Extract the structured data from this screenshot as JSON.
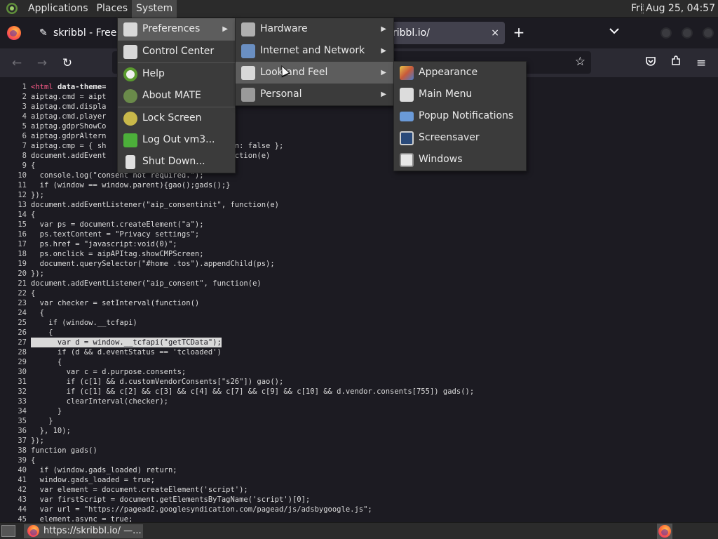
{
  "top_panel": {
    "menus": [
      "Applications",
      "Places",
      "System"
    ],
    "clock": "Fri Aug 25, 04:57"
  },
  "browser": {
    "tab1_title": "skribbl - Free M",
    "tab2_title": "ribbl.io/",
    "tab_close": "×",
    "new_tab": "+"
  },
  "system_menu": {
    "items": [
      "Preferences",
      "Control Center",
      "Help",
      "About MATE",
      "Lock Screen",
      "Log Out vm3...",
      "Shut Down..."
    ]
  },
  "preferences_menu": {
    "items": [
      "Hardware",
      "Internet and Network",
      "Look and Feel",
      "Personal"
    ]
  },
  "look_and_feel_menu": {
    "items": [
      "Appearance",
      "Main Menu",
      "Popup Notifications",
      "Screensaver",
      "Windows"
    ]
  },
  "code": {
    "line1_tag": "<html",
    "line1_attr": "data-theme=",
    "lines": [
      {
        "n": "1",
        "t": ""
      },
      {
        "n": "2",
        "t": "aiptag.cmd = aipt"
      },
      {
        "n": "3",
        "t": "aiptag.cmd.displa                 || [];"
      },
      {
        "n": "4",
        "t": "aiptag.cmd.player                 [];"
      },
      {
        "n": "5",
        "t": "aiptag.gdprShowCo"
      },
      {
        "n": "6",
        "t": "aiptag.gdprAltern                 e;"
      },
      {
        "n": "7",
        "t": "aiptag.cmp = { sh               ntered\", button: false };"
      },
      {
        "n": "8",
        "t": "document.addEvent               required\", function(e)"
      },
      {
        "n": "9",
        "t": "{"
      },
      {
        "n": "10",
        "t": "  console.log(\"consent not required.\");"
      },
      {
        "n": "11",
        "t": "  if (window == window.parent){gao();gads();}"
      },
      {
        "n": "12",
        "t": "});"
      },
      {
        "n": "13",
        "t": "document.addEventListener(\"aip_consentinit\", function(e)"
      },
      {
        "n": "14",
        "t": "{"
      },
      {
        "n": "15",
        "t": "  var ps = document.createElement(\"a\");"
      },
      {
        "n": "16",
        "t": "  ps.textContent = \"Privacy settings\";"
      },
      {
        "n": "17",
        "t": "  ps.href = \"javascript:void(0)\";"
      },
      {
        "n": "18",
        "t": "  ps.onclick = aipAPItag.showCMPScreen;"
      },
      {
        "n": "19",
        "t": "  document.querySelector(\"#home .tos\").appendChild(ps);"
      },
      {
        "n": "20",
        "t": "});"
      },
      {
        "n": "21",
        "t": "document.addEventListener(\"aip_consent\", function(e)"
      },
      {
        "n": "22",
        "t": "{"
      },
      {
        "n": "23",
        "t": "  var checker = setInterval(function()"
      },
      {
        "n": "24",
        "t": "  {"
      },
      {
        "n": "25",
        "t": "    if (window.__tcfapi)"
      },
      {
        "n": "26",
        "t": "    {"
      },
      {
        "n": "27",
        "t": "      var d = window.__tcfapi(\"getTCData\");"
      },
      {
        "n": "28",
        "t": "      if (d && d.eventStatus == 'tcloaded')"
      },
      {
        "n": "29",
        "t": "      {"
      },
      {
        "n": "30",
        "t": "        var c = d.purpose.consents;"
      },
      {
        "n": "31",
        "t": "        if (c[1] && d.customVendorConsents[\"s26\"]) gao();"
      },
      {
        "n": "32",
        "t": "        if (c[1] && c[2] && c[3] && c[4] && c[7] && c[9] && c[10] && d.vendor.consents[755]) gads();"
      },
      {
        "n": "33",
        "t": "        clearInterval(checker);"
      },
      {
        "n": "34",
        "t": "      }"
      },
      {
        "n": "35",
        "t": "    }"
      },
      {
        "n": "36",
        "t": "  }, 10);"
      },
      {
        "n": "37",
        "t": "});"
      },
      {
        "n": "38",
        "t": "function gads()"
      },
      {
        "n": "39",
        "t": "{"
      },
      {
        "n": "40",
        "t": "  if (window.gads_loaded) return;"
      },
      {
        "n": "41",
        "t": "  window.gads_loaded = true;"
      },
      {
        "n": "42",
        "t": "  var element = document.createElement('script');"
      },
      {
        "n": "43",
        "t": "  var firstScript = document.getElementsByTagName('script')[0];"
      },
      {
        "n": "44",
        "t": "  var url = \"https://pagead2.googlesyndication.com/pagead/js/adsbygoogle.js\";"
      },
      {
        "n": "45",
        "t": "  element.async = true;"
      }
    ]
  },
  "taskbar": {
    "window_title": "https://skribbl.io/ —..."
  },
  "colors": {
    "panel": "#2b2b2b",
    "menu_bg": "#3b3b3b",
    "menu_active": "#5d5d5d",
    "code_bg": "#1c1b22",
    "html_tag": "#ff5c8a"
  }
}
